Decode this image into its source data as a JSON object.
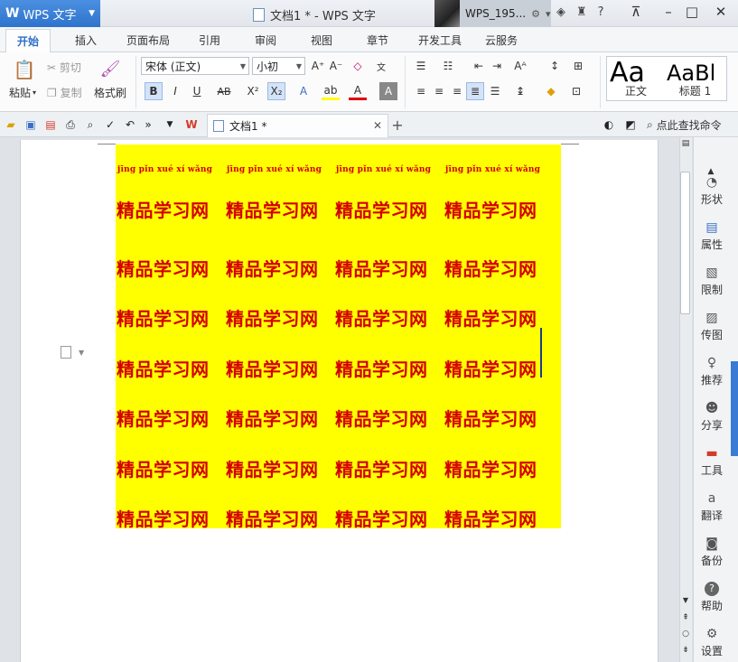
{
  "titlebar": {
    "app_name": "WPS 文字",
    "doc_title": "文档1 * - WPS 文字",
    "user_name": "WPS_195..."
  },
  "menu": {
    "tabs": [
      "开始",
      "插入",
      "页面布局",
      "引用",
      "审阅",
      "视图",
      "章节",
      "开发工具",
      "云服务"
    ]
  },
  "ribbon": {
    "paste": "粘贴",
    "cut": "剪切",
    "copy": "复制",
    "format_painter": "格式刷",
    "font_name": "宋体 (正文)",
    "font_size": "小初",
    "style_normal_label": "正文",
    "style_heading_label": "标题 1",
    "style_normal_sample": "Aa",
    "style_heading_sample": "AaBl"
  },
  "quickbar": {
    "doc_tab": "文档1 *",
    "search": "点此查找命令"
  },
  "document": {
    "pinyin": [
      "jīng pǐn xué  xí wǎng",
      "jīng pǐn xué  xí wǎng",
      "jīng pǐn xué  xí wǎng",
      "jīng pǐn xué  xí wǎng"
    ],
    "rows": [
      [
        "精品学习网",
        "精品学习网",
        "精品学习网",
        "精品学习网"
      ],
      [
        "精品学习网",
        "精品学习网",
        "精品学习网",
        "精品学习网"
      ],
      [
        "精品学习网",
        "精品学习网",
        "精品学习网",
        "精品学习网"
      ],
      [
        "精品学习网",
        "精品学习网",
        "精品学习网",
        "精品学习网"
      ],
      [
        "精品学习网",
        "精品学习网",
        "精品学习网",
        "精品学习网"
      ],
      [
        "精品学习网",
        "精品学习网",
        "精品学习网",
        "精品学习网"
      ],
      [
        "精品学习网",
        "精品学习网",
        "精品学习网",
        "精品学习网"
      ]
    ],
    "highlight_color": "#ffff00",
    "text_color": "#d40000"
  },
  "sidepanel": {
    "items": [
      "形状",
      "属性",
      "限制",
      "传图",
      "推荐",
      "分享",
      "工具",
      "翻译",
      "备份",
      "帮助",
      "设置"
    ]
  },
  "colors": {
    "accent": "#2f74cc",
    "active_tab": "#2e6fc7"
  }
}
